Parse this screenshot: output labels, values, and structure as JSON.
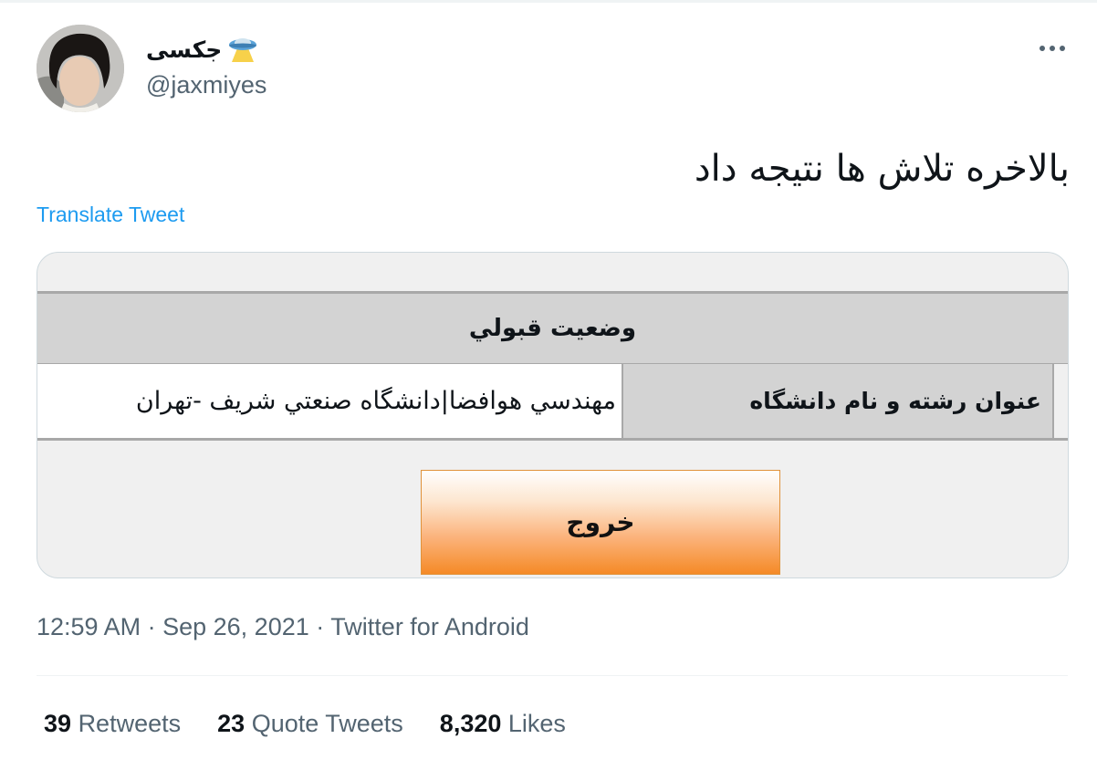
{
  "author": {
    "display_name": "جکسی",
    "handle": "@jaxmiyes",
    "emoji_icon": "ufo-icon"
  },
  "tweet": {
    "text": "بالاخره تلاش ها نتیجه داد",
    "translate_label": "Translate Tweet",
    "time": "12:59 AM",
    "date": "Sep 26, 2021",
    "source": "Twitter for Android",
    "dot": "·"
  },
  "media": {
    "section_title": "وضعيت قبولي",
    "field_label": "عنوان رشته و نام دانشگاه",
    "field_value": "مهندسي هوافضا|دانشگاه صنعتي شريف -تهران",
    "exit_button": "خروج"
  },
  "stats": {
    "retweets_count": "39",
    "retweets_label": "Retweets",
    "quotes_count": "23",
    "quotes_label": "Quote Tweets",
    "likes_count": "8,320",
    "likes_label": "Likes"
  },
  "colors": {
    "link": "#1d9bf0",
    "secondary_text": "#536471",
    "button_orange": "#f58a26"
  }
}
